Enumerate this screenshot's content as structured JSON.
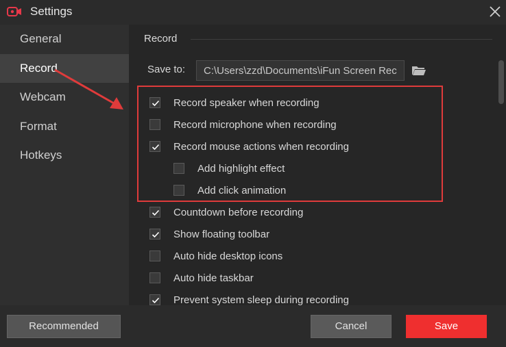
{
  "window": {
    "title": "Settings",
    "app_icon": "camera-icon",
    "close_icon": "close-icon"
  },
  "sidebar": {
    "items": [
      {
        "label": "General",
        "active": false
      },
      {
        "label": "Record",
        "active": true
      },
      {
        "label": "Webcam",
        "active": false
      },
      {
        "label": "Format",
        "active": false
      },
      {
        "label": "Hotkeys",
        "active": false
      }
    ]
  },
  "record": {
    "section_title": "Record",
    "save_to_label": "Save to:",
    "save_to_value": "C:\\Users\\zzd\\Documents\\iFun Screen Recorder",
    "folder_icon": "folder-icon",
    "options": [
      {
        "label": "Record speaker when recording",
        "checked": true
      },
      {
        "label": "Record microphone when recording",
        "checked": false
      },
      {
        "label": "Record mouse actions when recording",
        "checked": true
      },
      {
        "label": "Add highlight effect",
        "checked": false
      },
      {
        "label": "Add click animation",
        "checked": false
      },
      {
        "label": "Countdown before recording",
        "checked": true
      },
      {
        "label": "Show floating toolbar",
        "checked": true
      },
      {
        "label": "Auto hide desktop icons",
        "checked": false
      },
      {
        "label": "Auto hide taskbar",
        "checked": false
      },
      {
        "label": "Prevent system sleep during recording",
        "checked": true
      }
    ]
  },
  "footer": {
    "recommended_label": "Recommended",
    "cancel_label": "Cancel",
    "save_label": "Save"
  },
  "colors": {
    "accent": "#ef2f2f",
    "annotation": "#e03b3b",
    "background": "#262626",
    "sidebar": "#2f2f2f",
    "sidebar_active": "#414141"
  }
}
